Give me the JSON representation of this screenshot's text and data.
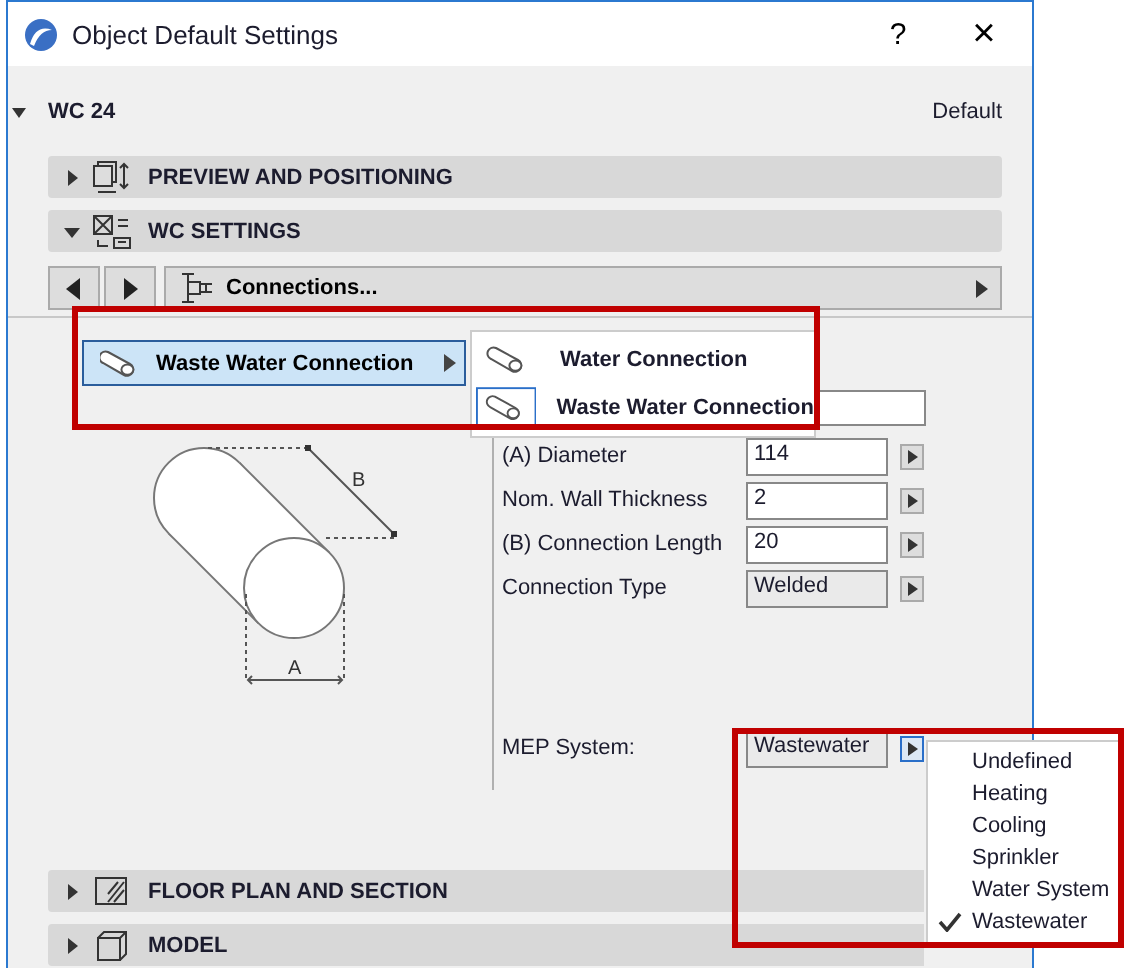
{
  "window": {
    "title": "Object Default Settings",
    "help": "?",
    "close": "×"
  },
  "object_name": "WC 24",
  "preset": "Default",
  "sections_top": [
    {
      "title": "PREVIEW AND POSITIONING",
      "expanded": false,
      "kind": "preview"
    },
    {
      "title": "WC SETTINGS",
      "expanded": true,
      "kind": "settings"
    }
  ],
  "page_selector": {
    "label": "Connections..."
  },
  "connection_button": {
    "label": "Waste Water Connection"
  },
  "connection_menu": [
    {
      "label": "Water Connection",
      "selected": false
    },
    {
      "label": "Waste Water Connection",
      "selected": true
    }
  ],
  "diagram": {
    "label_a": "A",
    "label_b": "B"
  },
  "parameters": [
    {
      "label": "(A) Diameter",
      "value": "114",
      "kind": "input"
    },
    {
      "label": "Nom. Wall Thickness",
      "value": "2",
      "kind": "input"
    },
    {
      "label": "(B) Connection Length",
      "value": "20",
      "kind": "input"
    },
    {
      "label": "Connection Type",
      "value": "Welded",
      "kind": "select"
    }
  ],
  "mep": {
    "label": "MEP System:",
    "value": "Wastewater",
    "options": [
      {
        "label": "Undefined",
        "selected": false
      },
      {
        "label": "Heating",
        "selected": false
      },
      {
        "label": "Cooling",
        "selected": false
      },
      {
        "label": "Sprinkler",
        "selected": false
      },
      {
        "label": "Water System",
        "selected": false
      },
      {
        "label": "Wastewater",
        "selected": true
      }
    ]
  },
  "sections_bottom": [
    {
      "title": "FLOOR PLAN AND SECTION",
      "expanded": false,
      "kind": "floorplan"
    },
    {
      "title": "MODEL",
      "expanded": false,
      "kind": "model"
    }
  ]
}
